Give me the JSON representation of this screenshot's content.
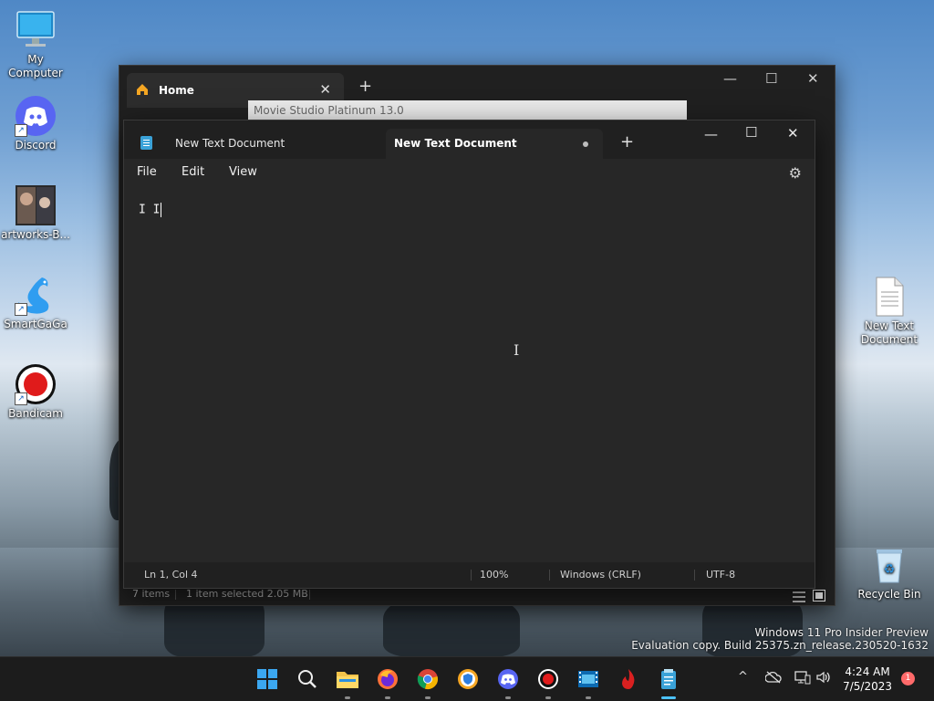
{
  "desktop": {
    "icons": [
      {
        "label": "My Computer"
      },
      {
        "label": "Discord"
      },
      {
        "label": "artworks-B..."
      },
      {
        "label": "SmartGaGa"
      },
      {
        "label": "Bandicam"
      },
      {
        "label": "New Text Document"
      },
      {
        "label": "Recycle Bin"
      }
    ]
  },
  "explorer": {
    "tab_label": "Home",
    "path_text": "Movie Studio Platinum 13.0",
    "status_items": "7 items",
    "status_selected": "1 item selected  2.05 MB"
  },
  "notepad": {
    "tabs": [
      {
        "label": "New Text Document"
      },
      {
        "label": "New Text Document"
      }
    ],
    "menu": {
      "file": "File",
      "edit": "Edit",
      "view": "View"
    },
    "content": "I I",
    "status": {
      "position": "Ln 1, Col 4",
      "zoom": "100%",
      "line_ending": "Windows (CRLF)",
      "encoding": "UTF-8"
    }
  },
  "watermark": {
    "line1": "Windows 11 Pro Insider Preview",
    "line2": "Evaluation copy. Build 25375.zn_release.230520-1632"
  },
  "taskbar": {
    "time": "4:24 AM",
    "date": "7/5/2023",
    "notification_count": "1"
  }
}
